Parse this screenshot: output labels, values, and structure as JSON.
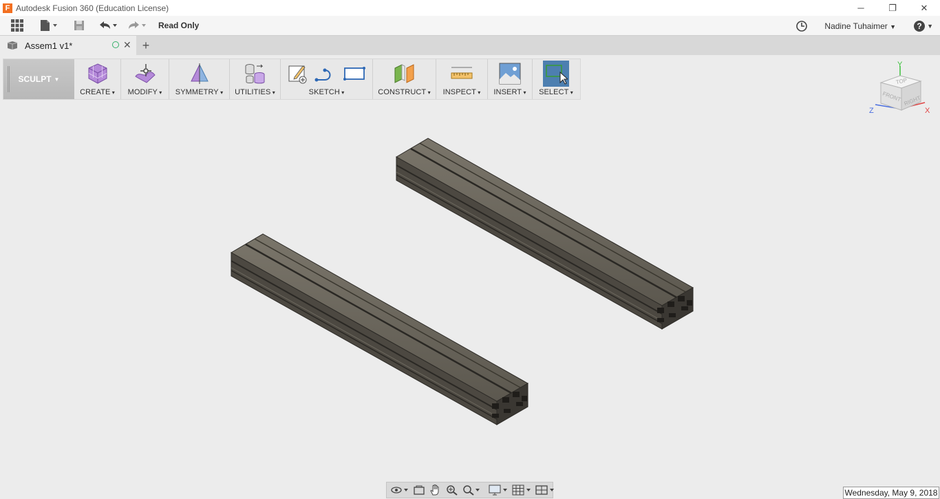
{
  "window": {
    "title": "Autodesk Fusion 360 (Education License)",
    "app_icon_letter": "F",
    "minimize": "─",
    "restore": "❐",
    "close": "✕"
  },
  "qat": {
    "read_only": "Read Only",
    "user_name": "Nadine Tuhaimer",
    "help": "?"
  },
  "tabs": {
    "active": {
      "label": "Assem1 v1*"
    },
    "close": "✕",
    "new_tab": "+"
  },
  "ribbon": {
    "workspace": "SCULPT",
    "groups": {
      "create": "CREATE",
      "modify": "MODIFY",
      "symmetry": "SYMMETRY",
      "utilities": "UTILITIES",
      "sketch": "SKETCH",
      "construct": "CONSTRUCT",
      "inspect": "INSPECT",
      "insert": "INSERT",
      "select": "SELECT"
    }
  },
  "viewcube": {
    "top": "TOP",
    "front": "FRONT",
    "right": "RIGHT",
    "axis_x": "X",
    "axis_y": "Y",
    "axis_z": "Z"
  },
  "status": {
    "date": "Wednesday, May 9, 2018"
  },
  "colors": {
    "extrusion_top": "#6b665c",
    "extrusion_side": "#4a463f",
    "extrusion_dark": "#2e2b27",
    "select_active": "#4d7fb0",
    "workspace_bg": "#bdbdbd"
  }
}
